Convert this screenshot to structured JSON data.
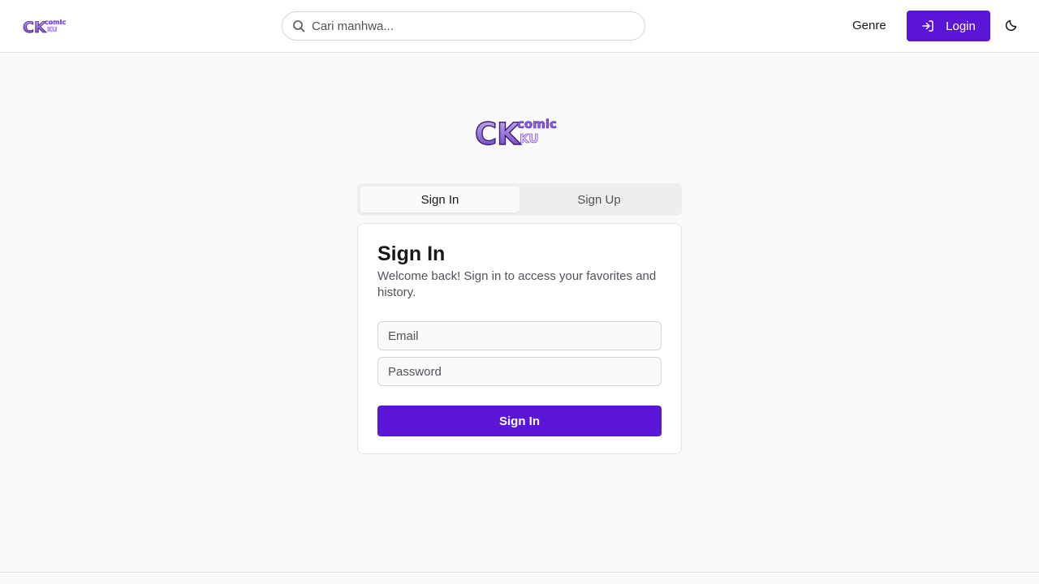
{
  "header": {
    "logo_alt": "ComicKu",
    "search": {
      "placeholder": "Cari manhwa...",
      "value": ""
    },
    "nav": {
      "genre_label": "Genre"
    },
    "login_label": "Login",
    "theme_icon": "moon-icon"
  },
  "main": {
    "logo_alt": "ComicKu",
    "tabs": [
      {
        "label": "Sign In",
        "active": true
      },
      {
        "label": "Sign Up",
        "active": false
      }
    ],
    "card": {
      "title": "Sign In",
      "description": "Welcome back! Sign in to access your favorites and history.",
      "email": {
        "placeholder": "Email",
        "value": ""
      },
      "password": {
        "placeholder": "Password",
        "value": ""
      },
      "submit_label": "Sign In"
    }
  },
  "colors": {
    "accent": "#5b15d9",
    "logo_purple": "#7c3aed",
    "logo_light": "#c4b5fd",
    "background": "#fafafa"
  }
}
